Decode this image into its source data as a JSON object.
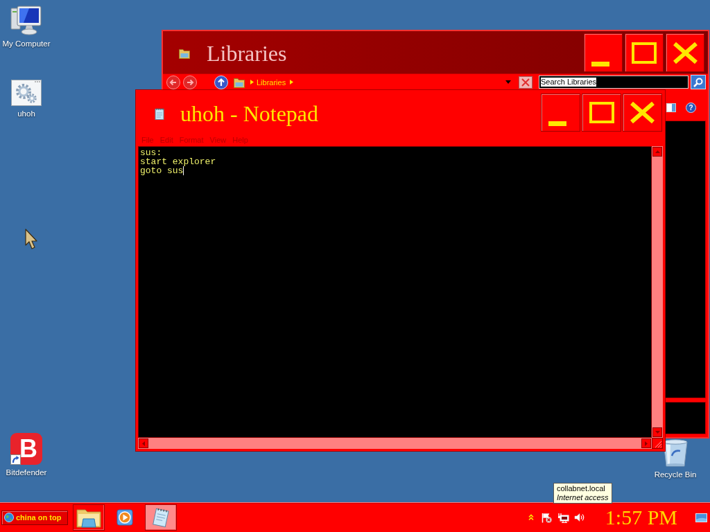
{
  "desktop": {
    "icons": [
      {
        "kind": "computer",
        "label": "My Computer",
        "shortcut": false
      },
      {
        "kind": "script",
        "label": "uhoh",
        "shortcut": false
      },
      {
        "kind": "logo",
        "label": "Bitdefender",
        "glyph": "B",
        "shortcut": true
      },
      {
        "kind": "recycle-bin",
        "label": "Recycle Bin",
        "shortcut": false
      }
    ]
  },
  "windows": [
    {
      "kind": "explorer",
      "title": "Libraries",
      "active": false,
      "address": "Libraries",
      "search": {
        "placeholder": "Search Libraries"
      },
      "help_button": {
        "label": "?"
      }
    },
    {
      "kind": "notepad",
      "title": "uhoh - Notepad",
      "active": true,
      "menu": [
        "File",
        "Edit",
        "Format",
        "View",
        "Help"
      ],
      "lines": [
        "sus:",
        "start explorer",
        "goto sus"
      ]
    }
  ],
  "tooltip": {
    "lines": [
      {
        "text": "collabnet.local",
        "italic": false
      },
      {
        "text": "Internet access",
        "italic": true
      }
    ]
  },
  "taskbar": {
    "start": {
      "label": "china on top"
    },
    "buttons": [
      {
        "kind": "explorer",
        "running": true,
        "selected": false
      },
      {
        "kind": "media-player",
        "running": false,
        "selected": false
      },
      {
        "kind": "notepad",
        "running": true,
        "selected": true
      }
    ],
    "tray": [
      {
        "kind": "chevron"
      },
      {
        "kind": "flag"
      },
      {
        "kind": "network"
      },
      {
        "kind": "volume"
      }
    ],
    "clock": "1:57 PM"
  }
}
